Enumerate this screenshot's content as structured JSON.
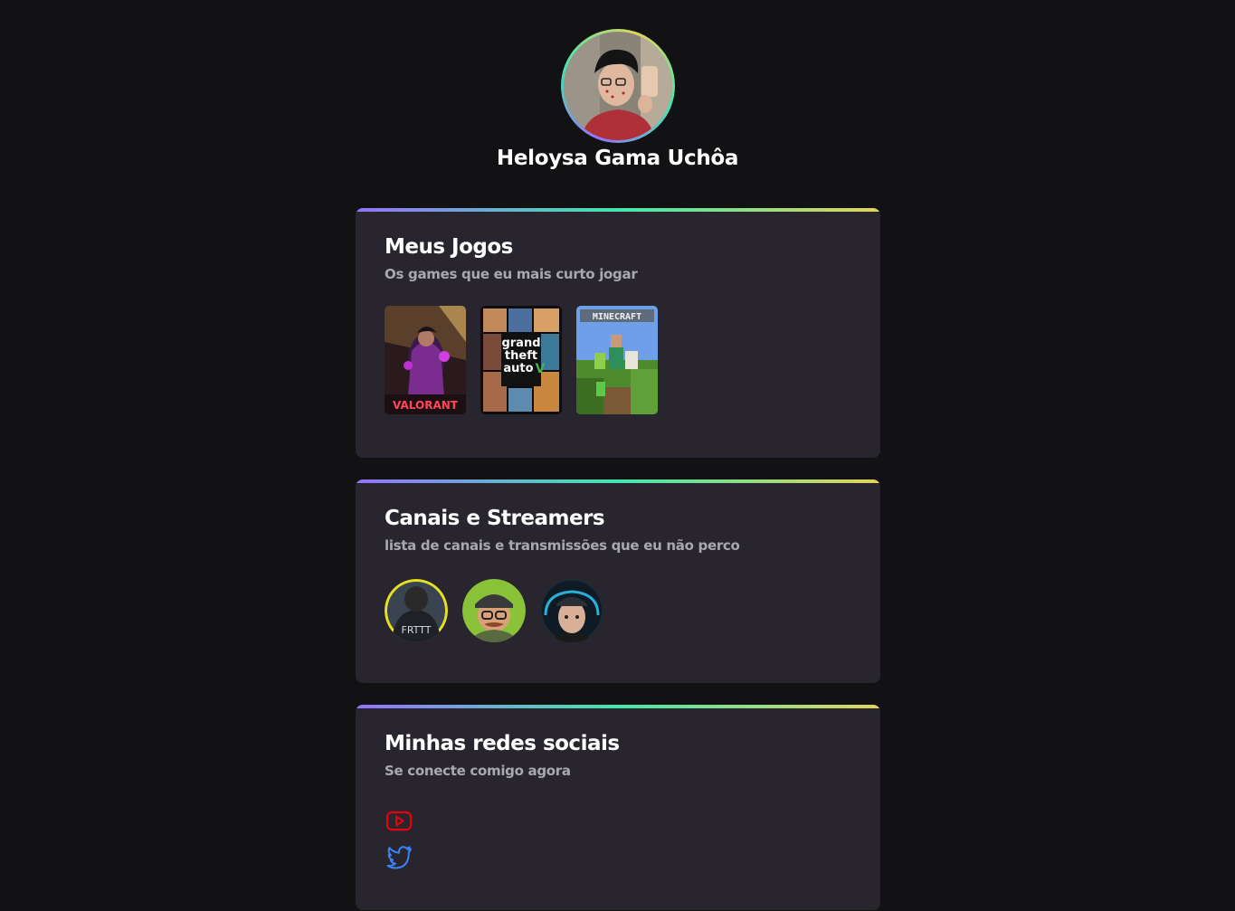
{
  "profile": {
    "name": "Heloysa Gama Uchôa",
    "avatar": "profile-photo"
  },
  "games_section": {
    "title": "Meus Jogos",
    "subtitle": "Os games que eu mais curto jogar",
    "games": [
      {
        "name": "Valorant",
        "cover_text": "VALORANT"
      },
      {
        "name": "Grand Theft Auto V",
        "cover_text": "grand theft auto V"
      },
      {
        "name": "Minecraft",
        "cover_text": "MINECRAFT"
      }
    ]
  },
  "streamers_section": {
    "title": "Canais e Streamers",
    "subtitle": "lista de canais e transmissões que eu não perco",
    "streamers": [
      {
        "avatar": "streamer-1"
      },
      {
        "avatar": "streamer-2"
      },
      {
        "avatar": "streamer-3"
      }
    ]
  },
  "social_section": {
    "title": "Minhas redes sociais",
    "subtitle": "Se conecte comigo agora",
    "links": [
      {
        "icon": "youtube-icon",
        "color": "#e5000b"
      },
      {
        "icon": "twitter-icon",
        "color": "#3b82f6"
      }
    ]
  },
  "colors": {
    "background": "#121214",
    "card": "#29252f",
    "gradient": [
      "#9572fc",
      "#43e7ad",
      "#e2d45c"
    ],
    "subtitle": "#a8a8b3"
  }
}
